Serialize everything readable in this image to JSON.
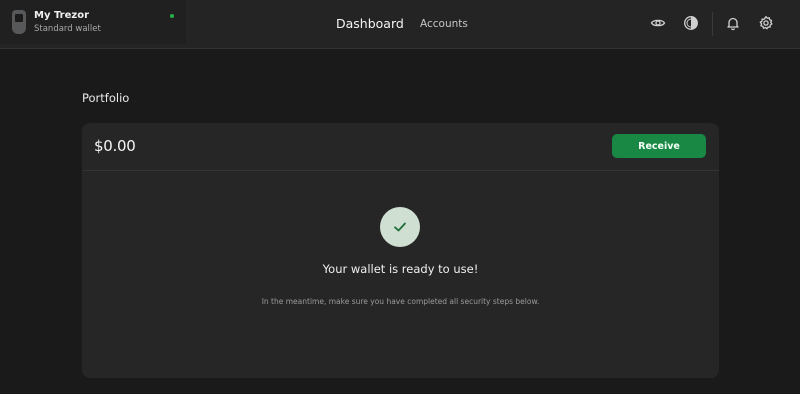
{
  "device": {
    "name": "My Trezor",
    "wallet_type": "Standard wallet",
    "status_color": "#22b04a"
  },
  "nav": {
    "tabs": [
      "Dashboard",
      "Accounts"
    ],
    "active": "Dashboard"
  },
  "toolbar": {
    "icons": [
      "eye-icon",
      "theme-contrast-icon",
      "bell-icon",
      "gear-icon"
    ]
  },
  "portfolio": {
    "title": "Portfolio",
    "balance": "$0.00",
    "receive_label": "Receive",
    "ready_title": "Your wallet is ready to use!",
    "ready_subtitle": "In the meantime, make sure you have completed all security steps below."
  },
  "colors": {
    "accent": "#198844",
    "background": "#1a1a1b",
    "card": "#262627"
  }
}
